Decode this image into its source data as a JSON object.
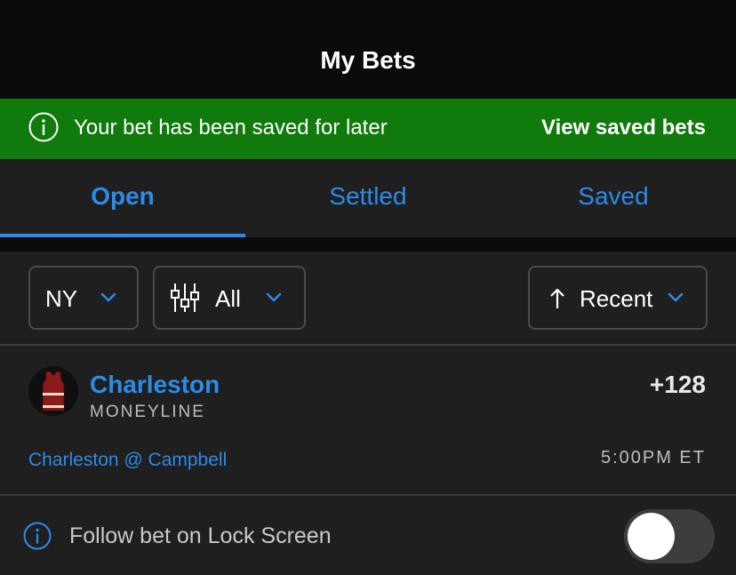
{
  "header": {
    "title": "My Bets"
  },
  "banner": {
    "message": "Your bet has been saved for later",
    "action_label": "View saved bets",
    "color": "#107a0c",
    "icon": "info-circle-icon"
  },
  "tabs": [
    {
      "label": "Open",
      "active": true
    },
    {
      "label": "Settled",
      "active": false
    },
    {
      "label": "Saved",
      "active": false
    }
  ],
  "filters": {
    "state": {
      "label": "NY",
      "icon": "chevron-down-icon"
    },
    "type": {
      "label": "All",
      "icon": "sliders-icon"
    },
    "sort": {
      "label": "Recent",
      "icon": "arrow-up-icon"
    }
  },
  "bet": {
    "team": "Charleston",
    "market": "MONEYLINE",
    "odds": "+128",
    "matchup": "Charleston @ Campbell",
    "time": "5:00PM ET",
    "jersey_color": "#8b1a1a"
  },
  "follow": {
    "label": "Follow bet on Lock Screen",
    "enabled": false
  },
  "colors": {
    "accent": "#2b8be8",
    "background": "#1f1f1f",
    "header": "#0b0b0b"
  }
}
